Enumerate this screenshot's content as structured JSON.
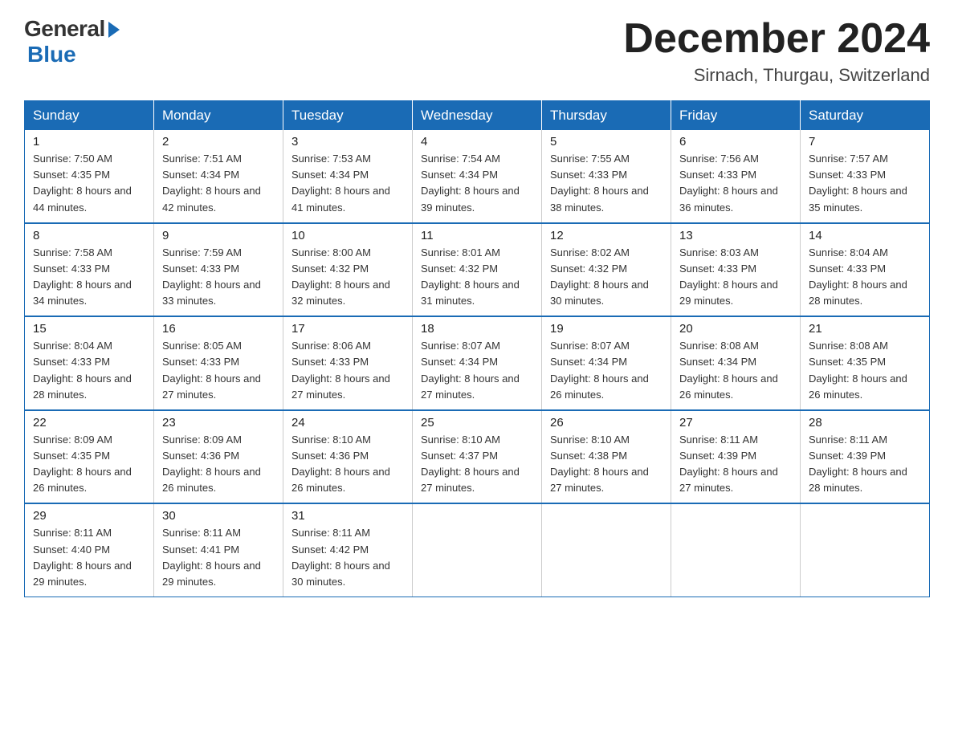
{
  "logo": {
    "general": "General",
    "blue": "Blue"
  },
  "title": "December 2024",
  "location": "Sirnach, Thurgau, Switzerland",
  "headers": [
    "Sunday",
    "Monday",
    "Tuesday",
    "Wednesday",
    "Thursday",
    "Friday",
    "Saturday"
  ],
  "weeks": [
    [
      {
        "day": "1",
        "sunrise": "7:50 AM",
        "sunset": "4:35 PM",
        "daylight": "8 hours and 44 minutes."
      },
      {
        "day": "2",
        "sunrise": "7:51 AM",
        "sunset": "4:34 PM",
        "daylight": "8 hours and 42 minutes."
      },
      {
        "day": "3",
        "sunrise": "7:53 AM",
        "sunset": "4:34 PM",
        "daylight": "8 hours and 41 minutes."
      },
      {
        "day": "4",
        "sunrise": "7:54 AM",
        "sunset": "4:34 PM",
        "daylight": "8 hours and 39 minutes."
      },
      {
        "day": "5",
        "sunrise": "7:55 AM",
        "sunset": "4:33 PM",
        "daylight": "8 hours and 38 minutes."
      },
      {
        "day": "6",
        "sunrise": "7:56 AM",
        "sunset": "4:33 PM",
        "daylight": "8 hours and 36 minutes."
      },
      {
        "day": "7",
        "sunrise": "7:57 AM",
        "sunset": "4:33 PM",
        "daylight": "8 hours and 35 minutes."
      }
    ],
    [
      {
        "day": "8",
        "sunrise": "7:58 AM",
        "sunset": "4:33 PM",
        "daylight": "8 hours and 34 minutes."
      },
      {
        "day": "9",
        "sunrise": "7:59 AM",
        "sunset": "4:33 PM",
        "daylight": "8 hours and 33 minutes."
      },
      {
        "day": "10",
        "sunrise": "8:00 AM",
        "sunset": "4:32 PM",
        "daylight": "8 hours and 32 minutes."
      },
      {
        "day": "11",
        "sunrise": "8:01 AM",
        "sunset": "4:32 PM",
        "daylight": "8 hours and 31 minutes."
      },
      {
        "day": "12",
        "sunrise": "8:02 AM",
        "sunset": "4:32 PM",
        "daylight": "8 hours and 30 minutes."
      },
      {
        "day": "13",
        "sunrise": "8:03 AM",
        "sunset": "4:33 PM",
        "daylight": "8 hours and 29 minutes."
      },
      {
        "day": "14",
        "sunrise": "8:04 AM",
        "sunset": "4:33 PM",
        "daylight": "8 hours and 28 minutes."
      }
    ],
    [
      {
        "day": "15",
        "sunrise": "8:04 AM",
        "sunset": "4:33 PM",
        "daylight": "8 hours and 28 minutes."
      },
      {
        "day": "16",
        "sunrise": "8:05 AM",
        "sunset": "4:33 PM",
        "daylight": "8 hours and 27 minutes."
      },
      {
        "day": "17",
        "sunrise": "8:06 AM",
        "sunset": "4:33 PM",
        "daylight": "8 hours and 27 minutes."
      },
      {
        "day": "18",
        "sunrise": "8:07 AM",
        "sunset": "4:34 PM",
        "daylight": "8 hours and 27 minutes."
      },
      {
        "day": "19",
        "sunrise": "8:07 AM",
        "sunset": "4:34 PM",
        "daylight": "8 hours and 26 minutes."
      },
      {
        "day": "20",
        "sunrise": "8:08 AM",
        "sunset": "4:34 PM",
        "daylight": "8 hours and 26 minutes."
      },
      {
        "day": "21",
        "sunrise": "8:08 AM",
        "sunset": "4:35 PM",
        "daylight": "8 hours and 26 minutes."
      }
    ],
    [
      {
        "day": "22",
        "sunrise": "8:09 AM",
        "sunset": "4:35 PM",
        "daylight": "8 hours and 26 minutes."
      },
      {
        "day": "23",
        "sunrise": "8:09 AM",
        "sunset": "4:36 PM",
        "daylight": "8 hours and 26 minutes."
      },
      {
        "day": "24",
        "sunrise": "8:10 AM",
        "sunset": "4:36 PM",
        "daylight": "8 hours and 26 minutes."
      },
      {
        "day": "25",
        "sunrise": "8:10 AM",
        "sunset": "4:37 PM",
        "daylight": "8 hours and 27 minutes."
      },
      {
        "day": "26",
        "sunrise": "8:10 AM",
        "sunset": "4:38 PM",
        "daylight": "8 hours and 27 minutes."
      },
      {
        "day": "27",
        "sunrise": "8:11 AM",
        "sunset": "4:39 PM",
        "daylight": "8 hours and 27 minutes."
      },
      {
        "day": "28",
        "sunrise": "8:11 AM",
        "sunset": "4:39 PM",
        "daylight": "8 hours and 28 minutes."
      }
    ],
    [
      {
        "day": "29",
        "sunrise": "8:11 AM",
        "sunset": "4:40 PM",
        "daylight": "8 hours and 29 minutes."
      },
      {
        "day": "30",
        "sunrise": "8:11 AM",
        "sunset": "4:41 PM",
        "daylight": "8 hours and 29 minutes."
      },
      {
        "day": "31",
        "sunrise": "8:11 AM",
        "sunset": "4:42 PM",
        "daylight": "8 hours and 30 minutes."
      },
      null,
      null,
      null,
      null
    ]
  ]
}
